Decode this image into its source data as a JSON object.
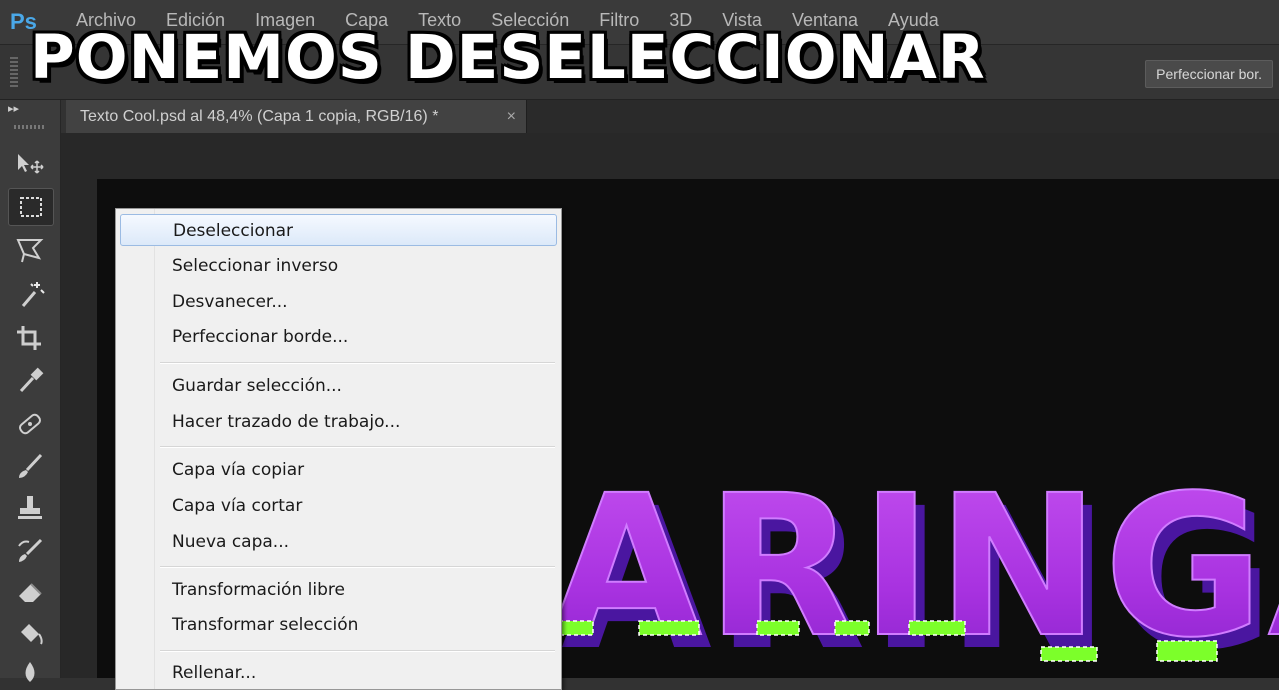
{
  "caption": "PONEMOS DESELECCIONAR",
  "app": {
    "logo": "Ps",
    "menu": [
      "Archivo",
      "Edición",
      "Imagen",
      "Capa",
      "Texto",
      "Selección",
      "Filtro",
      "3D",
      "Vista",
      "Ventana",
      "Ayuda"
    ]
  },
  "options_bar": {
    "refine_button": "Perfeccionar bor."
  },
  "document_tab": {
    "title": "Texto Cool.psd al 48,4% (Capa 1 copia, RGB/16) *",
    "close": "×"
  },
  "toolbox": {
    "expand": "▸▸",
    "tools": [
      "move-tool",
      "marquee-tool",
      "lasso-tool",
      "magic-wand-tool",
      "crop-tool",
      "eyedropper-tool",
      "healing-brush-tool",
      "brush-tool",
      "clone-stamp-tool",
      "history-brush-tool",
      "eraser-tool",
      "paint-bucket-tool",
      "blur-tool"
    ]
  },
  "artwork": {
    "text": "ARINGA",
    "colors": {
      "fill": "#b43ce8",
      "shadow": "#5a1aa8",
      "highlight": "#d47cff",
      "selection": "#7cff2a"
    }
  },
  "context_menu": {
    "items": [
      "Deseleccionar",
      "Seleccionar inverso",
      "Desvanecer...",
      "Perfeccionar borde...",
      "Guardar selección...",
      "Hacer trazado de trabajo...",
      "Capa vía copiar",
      "Capa vía cortar",
      "Nueva capa...",
      "Transformación libre",
      "Transformar selección",
      "Rellenar..."
    ],
    "highlighted": "Deseleccionar"
  }
}
